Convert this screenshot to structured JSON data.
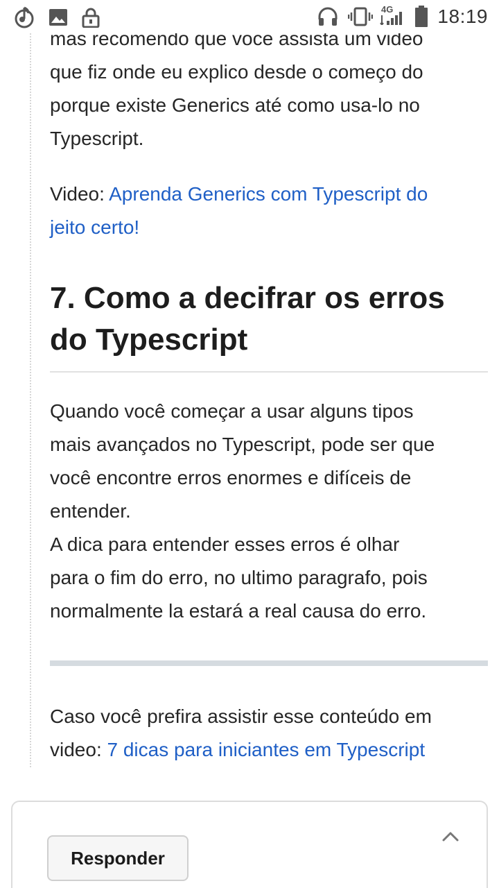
{
  "status_bar": {
    "time": "18:19",
    "network": "4G",
    "icons": [
      "music-icon",
      "image-icon",
      "lock-icon",
      "headphones-icon",
      "vibrate-icon",
      "signal-icon",
      "battery-icon"
    ]
  },
  "article": {
    "intro_paragraph": [
      "mas recomendo que voce assista um video",
      "que fiz onde eu explico desde o começo do",
      "porque existe Generics até como usa-lo no",
      "Typescript."
    ],
    "video_label": "Video: ",
    "video_link_lines": [
      "Aprenda Generics com Typescript do",
      "jeito certo!"
    ],
    "heading_lines": [
      "7. Como a decifrar os erros",
      "do Typescript"
    ],
    "body_paragraph": [
      "Quando você começar a usar alguns tipos",
      "mais avançados no Typescript, pode ser que",
      "você encontre erros enormes e difíceis de",
      "entender.",
      "A dica para entender esses erros é olhar",
      "para o fim do erro, no ultimo paragrafo, pois",
      "normalmente la estará a real causa do erro."
    ],
    "outro_line1": "Caso você prefira assistir esse conteúdo em",
    "outro_prefix": "video: ",
    "outro_link": "7 dicas para iniciantes em Typescript"
  },
  "reply": {
    "button_label": "Responder"
  },
  "colors": {
    "link": "#1f5fc6",
    "text": "#262626",
    "divider": "#d5dbe0"
  }
}
